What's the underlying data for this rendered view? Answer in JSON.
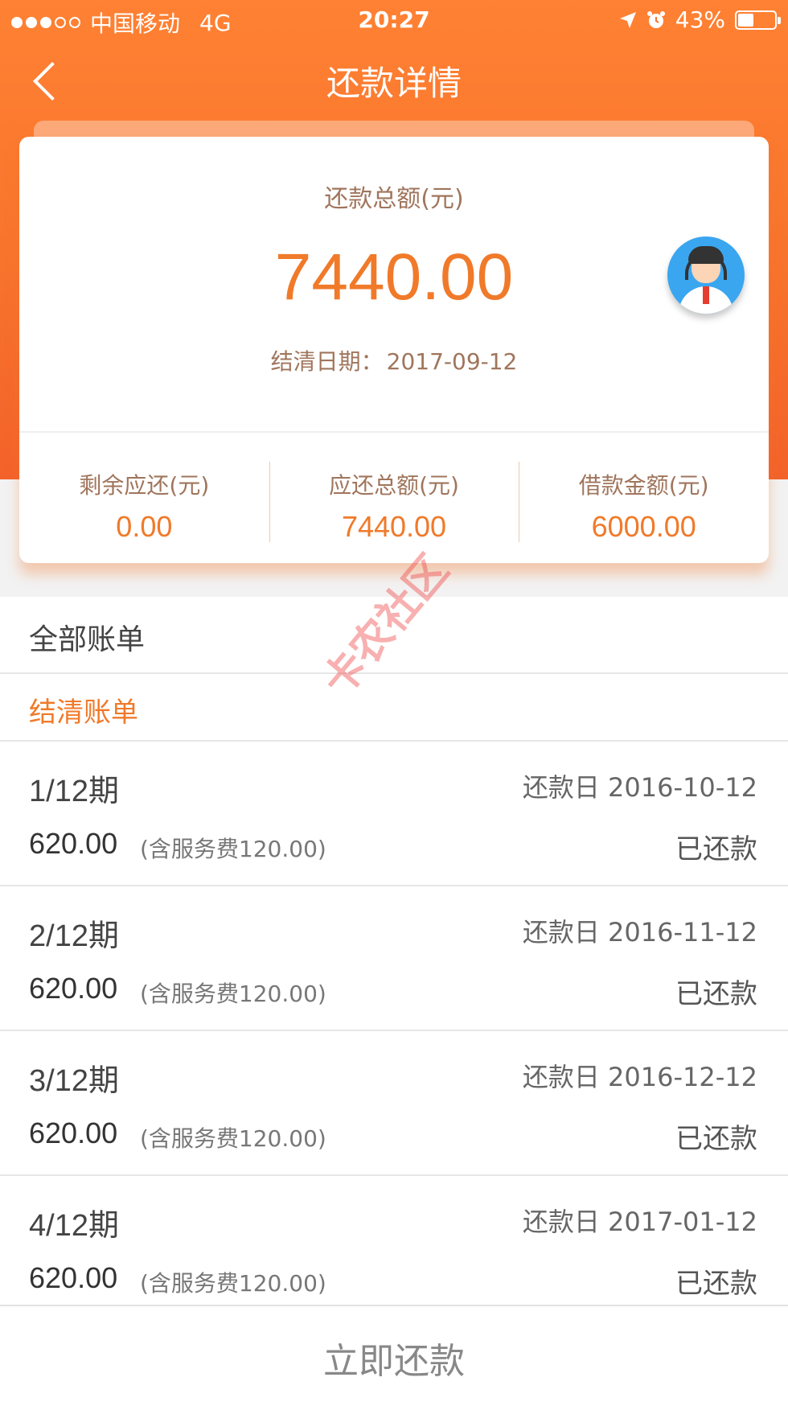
{
  "status_bar": {
    "carrier": "中国移动",
    "network": "4G",
    "time": "20:27",
    "battery_text": "43%",
    "battery_level": 0.43,
    "signal_strength": 3,
    "signal_max": 5
  },
  "nav": {
    "title": "还款详情",
    "back_icon": "chevron-left-icon"
  },
  "summary": {
    "total_label": "还款总额(元)",
    "total_amount": "7440.00",
    "settle_date_label": "结清日期：",
    "settle_date": "2017-09-12",
    "avatar_icon": "customer-service-icon",
    "stats": [
      {
        "label": "剩余应还(元)",
        "value": "0.00"
      },
      {
        "label": "应还总额(元)",
        "value": "7440.00"
      },
      {
        "label": "借款金额(元)",
        "value": "6000.00"
      }
    ]
  },
  "sections": {
    "all_bills": "全部账单",
    "settled_bills": "结清账单"
  },
  "bills": [
    {
      "period": "1/12期",
      "date_label": "还款日",
      "date": "2016-10-12",
      "amount": "620.00",
      "fee_note": "(含服务费120.00)",
      "status": "已还款"
    },
    {
      "period": "2/12期",
      "date_label": "还款日",
      "date": "2016-11-12",
      "amount": "620.00",
      "fee_note": "(含服务费120.00)",
      "status": "已还款"
    },
    {
      "period": "3/12期",
      "date_label": "还款日",
      "date": "2016-12-12",
      "amount": "620.00",
      "fee_note": "(含服务费120.00)",
      "status": "已还款"
    },
    {
      "period": "4/12期",
      "date_label": "还款日",
      "date": "2017-01-12",
      "amount": "620.00",
      "fee_note": "(含服务费120.00)",
      "status": "已还款"
    }
  ],
  "bottom": {
    "pay_now": "立即还款"
  },
  "watermark": "卡农社区",
  "colors": {
    "brand_orange": "#f07a2a",
    "header_gradient_top": "#ff8133",
    "header_gradient_bottom": "#f3622a",
    "label_brown": "#a0755c",
    "disabled_gray": "#888888"
  }
}
